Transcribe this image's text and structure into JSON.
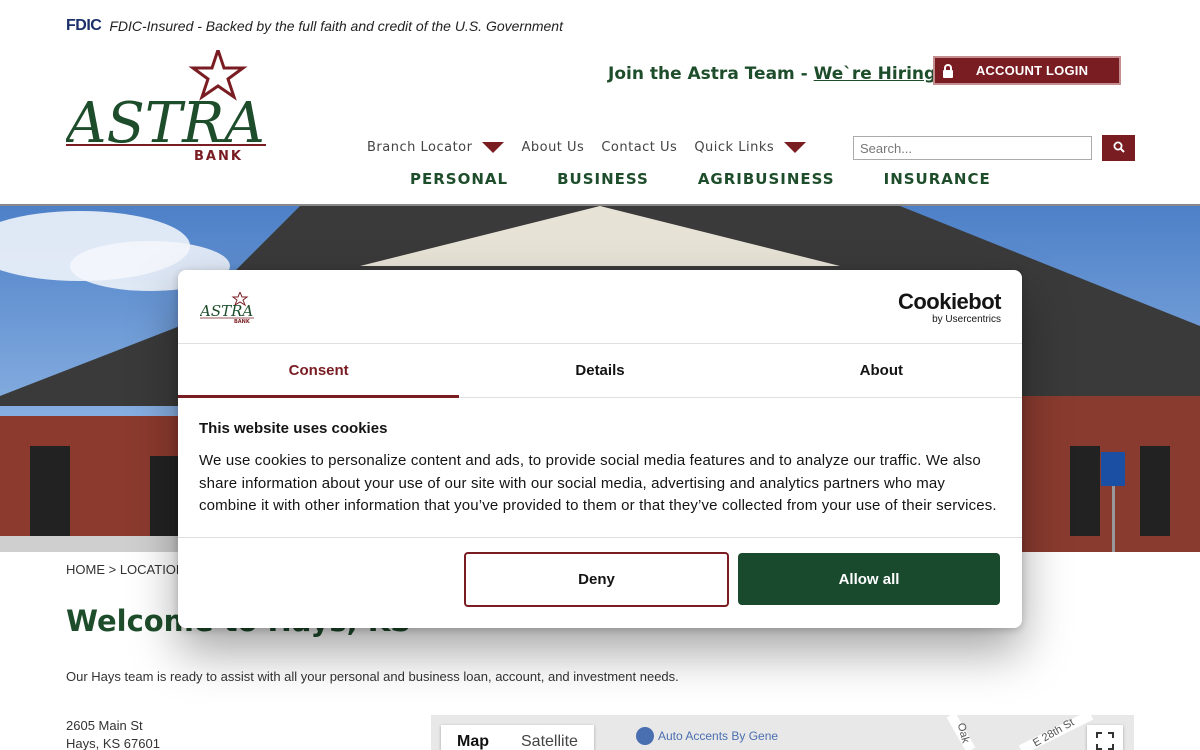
{
  "fdic": {
    "logo_text": "FDIC",
    "tagline": "FDIC-Insured - Backed by the full faith and credit of the U.S. Government"
  },
  "brand": {
    "name": "ASTRA",
    "sub": "BANK",
    "green": "#1e4d2b",
    "maroon": "#7a1d23"
  },
  "header": {
    "hiring_prefix": "Join the Astra Team - ",
    "hiring_link": "We`re Hiring!",
    "login_label": "ACCOUNT LOGIN",
    "login_icon": "lock-icon"
  },
  "util_nav": {
    "branch_locator": "Branch Locator",
    "about": "About Us",
    "contact": "Contact Us",
    "quick_links": "Quick Links"
  },
  "search": {
    "placeholder": "Search...",
    "icon": "search-icon"
  },
  "main_nav": {
    "personal": "PERSONAL",
    "business": "BUSINESS",
    "agribusiness": "AGRIBUSINESS",
    "insurance": "INSURANCE"
  },
  "page": {
    "breadcrumb": "HOME > LOCATION",
    "title": "Welcome to Hays, KS",
    "intro": "Our Hays team is ready to assist with all your personal and business loan, account, and investment needs.",
    "address_line1": "2605 Main St",
    "address_line2": "Hays, KS 67601"
  },
  "map": {
    "map_label": "Map",
    "satellite_label": "Satellite",
    "place": "Auto Accents By Gene",
    "road_oak": "Oak",
    "road_28th": "E 28th St"
  },
  "cookie": {
    "brand": "Cookiebot",
    "brand_sub": "by Usercentrics",
    "tabs": [
      "Consent",
      "Details",
      "About"
    ],
    "heading": "This website uses cookies",
    "body": "We use cookies to personalize content and ads, to provide social media features and to analyze our traffic. We also share information about your use of our site with our social media, advertising and analytics partners who may combine it with other information that you’ve provided to them or that they’ve collected from your use of their services.",
    "deny_label": "Deny",
    "allow_label": "Allow all"
  }
}
